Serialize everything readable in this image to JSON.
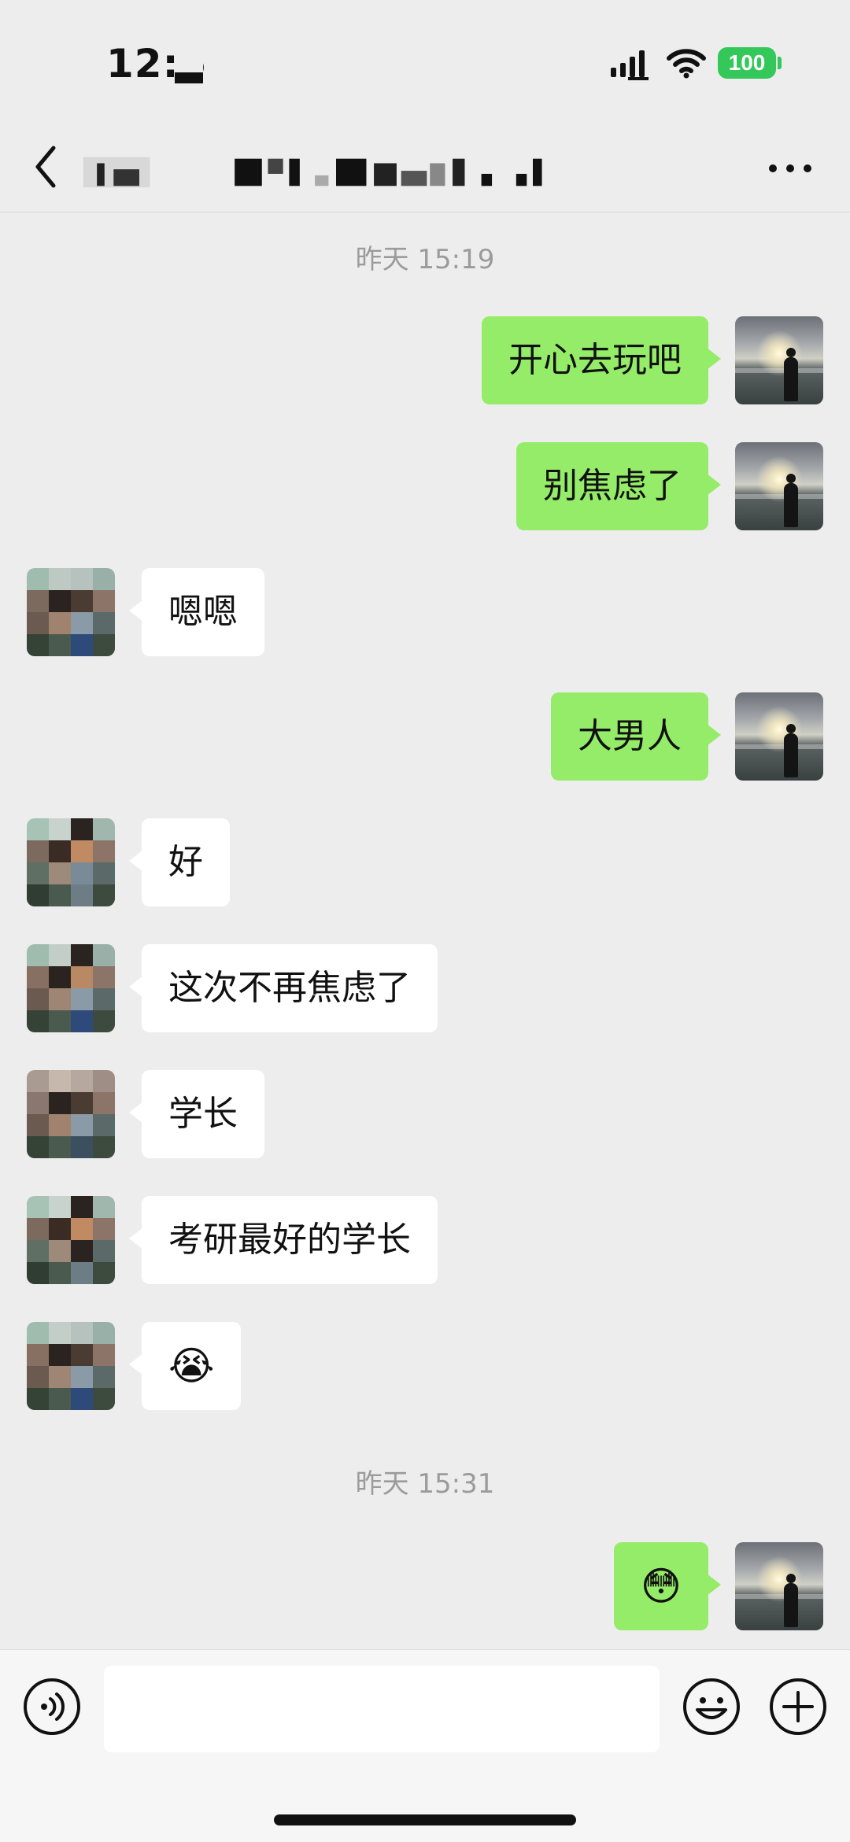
{
  "status_bar": {
    "time": "12:5",
    "battery": "100"
  },
  "header": {
    "more_icon": "more-icon"
  },
  "chat": {
    "timestamps": [
      "昨天 15:19",
      "昨天 15:31"
    ],
    "messages": [
      {
        "side": "me",
        "text": "开心去玩吧"
      },
      {
        "side": "me",
        "text": "别焦虑了"
      },
      {
        "side": "them",
        "text": "嗯嗯"
      },
      {
        "side": "me",
        "text": "大男人"
      },
      {
        "side": "them",
        "text": "好"
      },
      {
        "side": "them",
        "text": "这次不再焦虑了"
      },
      {
        "side": "them",
        "text": "学长"
      },
      {
        "side": "them",
        "text": "考研最好的学长"
      },
      {
        "side": "them",
        "text": "😭"
      },
      {
        "side": "me",
        "text": "😳"
      }
    ]
  },
  "input_bar": {
    "voice_icon": "voice-icon",
    "emoji_icon": "smile-icon",
    "plus_icon": "plus-icon"
  },
  "colors": {
    "background": "#ededed",
    "bubble_me": "#95ec69",
    "bubble_them": "#ffffff",
    "battery": "#34c759"
  }
}
